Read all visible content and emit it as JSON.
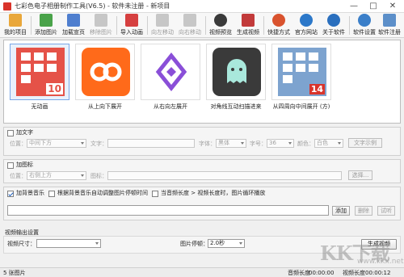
{
  "window": {
    "title": "七彩色电子相册制作工具(V6.5) - 软件未注册 - 新项目",
    "minimize_glyph": "—",
    "maximize_glyph": "□",
    "close_glyph": "✕"
  },
  "toolbar": {
    "items": [
      {
        "label": "我的项目",
        "icon": "folder-icon",
        "color": "#e9a73a"
      },
      {
        "label": "添加图片",
        "icon": "add-image-icon",
        "color": "#4aa34a"
      },
      {
        "label": "加载宣页",
        "icon": "load-page-icon",
        "color": "#4f7fcf"
      },
      {
        "label": "移除图片",
        "icon": "remove-image-icon",
        "color": "#8c8c8c"
      },
      {
        "label": "导入动画",
        "icon": "import-animation-icon",
        "color": "#d64040"
      },
      {
        "label": "向左移动",
        "icon": "move-left-icon",
        "color": "#8c8c8c"
      },
      {
        "label": "向右移动",
        "icon": "move-right-icon",
        "color": "#8c8c8c"
      },
      {
        "label": "视频预览",
        "icon": "video-preview-icon",
        "color": "#3a3a3a"
      },
      {
        "label": "生成视频",
        "icon": "generate-video-icon",
        "color": "#c23a3a"
      },
      {
        "label": "快捷方式",
        "icon": "shortcut-icon",
        "color": "#d9532e"
      },
      {
        "label": "官方网站",
        "icon": "website-icon",
        "color": "#2c78c9"
      },
      {
        "label": "关于软件",
        "icon": "about-icon",
        "color": "#2a6fbe"
      },
      {
        "label": "软件设置",
        "icon": "settings-icon",
        "color": "#3b7fc9"
      },
      {
        "label": "软件注册",
        "icon": "register-icon",
        "color": "#5c8fc9"
      }
    ]
  },
  "gallery": {
    "items": [
      {
        "label": "无动画",
        "art_color": "#e55248",
        "badge": "10"
      },
      {
        "label": "从上向下展开",
        "art_color": "#ff6a1a",
        "badge": ""
      },
      {
        "label": "从右向左展开",
        "art_color": "#8a4fd8",
        "badge": ""
      },
      {
        "label": "对角线互动扫描进来",
        "art_color": "#3a3a3a",
        "badge": ""
      },
      {
        "label": "从四周向中间展开 (方)",
        "art_color": "#7da3cf",
        "badge": "14"
      }
    ]
  },
  "text_section": {
    "toggle_label": "加文字",
    "position_label": "位置：",
    "position_value": "中间下方",
    "text_label": "文字：",
    "font_label": "字体：",
    "font_value": "黑体",
    "size_label": "字号：",
    "size_value": "36",
    "color_label": "颜色：",
    "color_value": "白色",
    "sample_button": "文字示例"
  },
  "icon_section": {
    "toggle_label": "加图标",
    "position_label": "位置：",
    "position_value": "右侧上方",
    "icon_label": "图标：",
    "choose_button": "选择..."
  },
  "music_section": {
    "toggle_label": "加背景音乐",
    "auto_adjust_label": "根据背景音乐自动调整图片停顿时间",
    "loop_label": "当音频长度 > 视频长度时，图片循环播放",
    "add_button": "添加",
    "delete_button": "删除",
    "preview_button": "试听"
  },
  "output_section": {
    "title": "视频输出设置",
    "size_label": "视频尺寸：",
    "pause_label": "图片停顿：",
    "pause_value": "2.0秒",
    "generate_button": "生成视频"
  },
  "status": {
    "count": "5 张图片",
    "audio_length_label": "音频长度",
    "audio_length_value": "00:00:00",
    "video_length_label": "视频长度",
    "video_length_value": "00:00:12"
  },
  "watermark": {
    "text": "KK下载",
    "sub": "www.kkx.net"
  }
}
